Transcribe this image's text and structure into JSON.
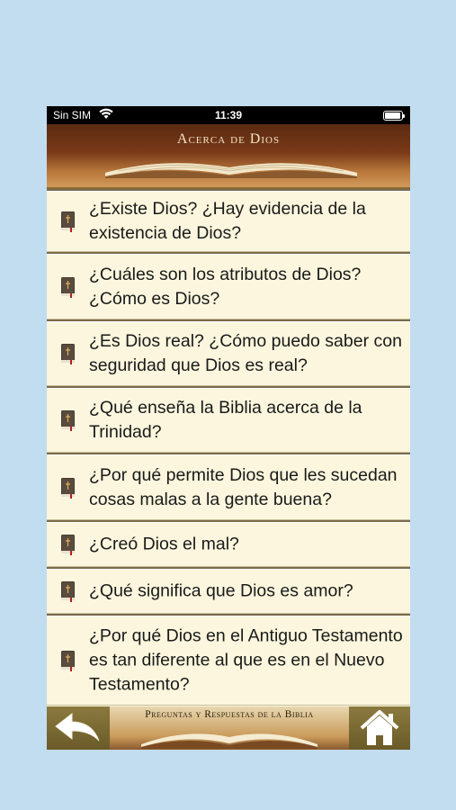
{
  "status_bar": {
    "carrier": "Sin SIM",
    "time": "11:39"
  },
  "header": {
    "title": "Acerca de Dios"
  },
  "items": [
    {
      "label": "¿Existe Dios? ¿Hay evidencia de la existencia de Dios?",
      "height": 68
    },
    {
      "label": "¿Cuáles son los atributos de Dios? ¿Cómo es Dios?",
      "height": 73
    },
    {
      "label": "¿Es Dios real? ¿Cómo puedo saber con seguridad que Dios es real?",
      "height": 72
    },
    {
      "label": "¿Qué enseña la Biblia acerca de la Trinidad?",
      "height": 72
    },
    {
      "label": "¿Por qué permite Dios que les sucedan cosas malas a la gente buena?",
      "height": 73
    },
    {
      "label": "¿Creó Dios el mal?",
      "height": 50
    },
    {
      "label": "¿Qué significa que Dios es amor?",
      "height": 50
    },
    {
      "label": "¿Por qué Dios en el Antiguo Testamento es tan diferente al que es en el Nuevo Testamento?",
      "height": 100
    }
  ],
  "footer": {
    "banner_title": "Preguntas y Respuestas de la Biblia",
    "back_icon": "back-arrow-icon",
    "home_icon": "home-icon"
  },
  "colors": {
    "background": "#c2dcf0",
    "list_bg": "#fbf6dd",
    "footer": "#6b5a2e"
  }
}
